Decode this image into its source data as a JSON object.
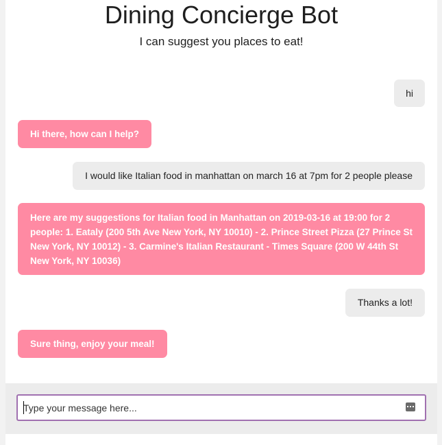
{
  "header": {
    "title": "Dining Concierge Bot",
    "subtitle": "I can suggest you places to eat!"
  },
  "messages": [
    {
      "sender": "user",
      "text": "hi"
    },
    {
      "sender": "bot",
      "text": "Hi there, how can I help?"
    },
    {
      "sender": "user",
      "text": "I would like Italian food in manhattan on march 16 at 7pm for 2 people please"
    },
    {
      "sender": "bot",
      "text": "Here are my suggestions for Italian food in Manhattan on 2019-03-16 at 19:00 for 2 people: 1. Eataly (200 5th Ave New York, NY 10010) - 2. Prince Street Pizza (27 Prince St New York, NY 10012) - 3. Carmine's Italian Restaurant - Times Square (200 W 44th St New York, NY 10036)"
    },
    {
      "sender": "user",
      "text": "Thanks a lot!"
    },
    {
      "sender": "bot",
      "text": "Sure thing, enjoy your meal!"
    }
  ],
  "composer": {
    "placeholder": "Type your message here...",
    "value": "",
    "icon": "keyboard-icon"
  },
  "colors": {
    "bot_bubble": "#ff8aa3",
    "user_bubble": "#ececec",
    "input_border": "#a070b0"
  }
}
